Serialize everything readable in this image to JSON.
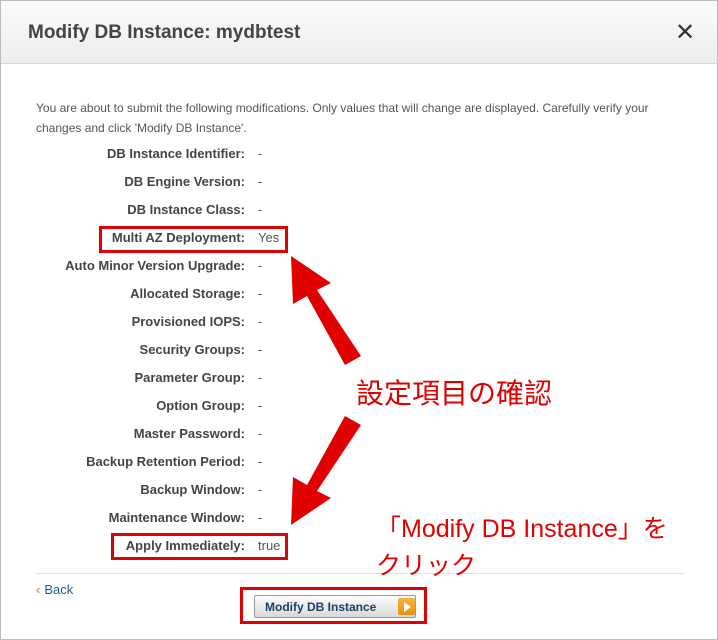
{
  "dialog": {
    "title": "Modify DB Instance: mydbtest",
    "close_symbol": "✕",
    "intro": "You are about to submit the following modifications. Only values that will change are displayed. Carefully verify your changes and click 'Modify DB Instance'."
  },
  "fields": [
    {
      "label": "DB Instance Identifier:",
      "value": "-"
    },
    {
      "label": "DB Engine Version:",
      "value": "-"
    },
    {
      "label": "DB Instance Class:",
      "value": "-"
    },
    {
      "label": "Multi AZ Deployment:",
      "value": "Yes"
    },
    {
      "label": "Auto Minor Version Upgrade:",
      "value": "-"
    },
    {
      "label": "Allocated Storage:",
      "value": "-"
    },
    {
      "label": "Provisioned IOPS:",
      "value": "-"
    },
    {
      "label": "Security Groups:",
      "value": "-"
    },
    {
      "label": "Parameter Group:",
      "value": "-"
    },
    {
      "label": "Option Group:",
      "value": "-"
    },
    {
      "label": "Master Password:",
      "value": "-"
    },
    {
      "label": "Backup Retention Period:",
      "value": "-"
    },
    {
      "label": "Backup Window:",
      "value": "-"
    },
    {
      "label": "Maintenance Window:",
      "value": "-"
    },
    {
      "label": "Apply Immediately:",
      "value": "true"
    }
  ],
  "footer": {
    "back_chevron": "‹",
    "back_label": "Back",
    "modify_label": "Modify DB Instance"
  },
  "annotations": {
    "confirm": "設定項目の確認",
    "click_line1": "「Modify DB Instance」を",
    "click_line2": "クリック"
  },
  "colors": {
    "annotation_red": "#e00000",
    "button_accent": "#f0a020",
    "link": "#1a5c8e"
  }
}
